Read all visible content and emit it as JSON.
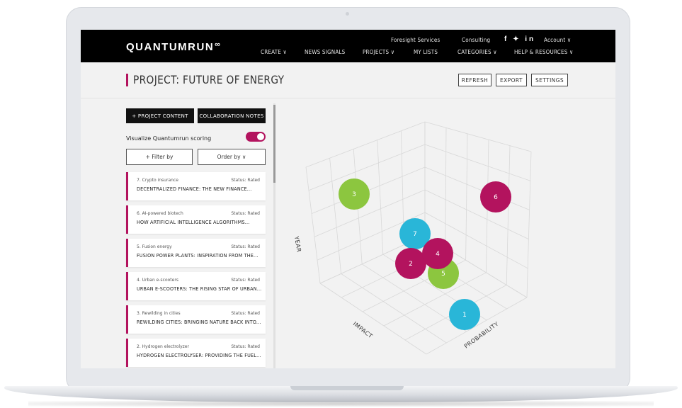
{
  "nav": {
    "logo": "QUANTUMRUN",
    "top": {
      "foresight": "Foresight Services",
      "consulting": "Consulting",
      "social": "f ✦ in",
      "account": "Account ∨"
    },
    "bottom": {
      "create": "CREATE ∨",
      "news": "NEWS SIGNALS",
      "projects": "PROJECTS ∨",
      "lists": "MY LISTS",
      "categories": "CATEGORIES ∨",
      "help": "HELP & RESOURCES ∨"
    }
  },
  "header": {
    "title": "PROJECT: FUTURE OF ENERGY",
    "refresh": "REFRESH",
    "export": "EXPORT",
    "settings": "SETTINGS"
  },
  "panel": {
    "project_content": "+ PROJECT CONTENT",
    "collab_notes": "COLLABORATION NOTES",
    "toggle_label": "Visualize Quantumrun scoring",
    "filter": "+ Filter by",
    "order": "Order by ∨",
    "items": [
      {
        "topic": "7. Crypto insurance",
        "status": "Status: Rated",
        "title": "DECENTRALIZED FINANCE: THE NEW FINANCE..."
      },
      {
        "topic": "6. AI-powered biotech",
        "status": "Status: Rated",
        "title": "HOW ARTIFICIAL INTELLIGENCE ALGORITHMS..."
      },
      {
        "topic": "5. Fusion energy",
        "status": "Status: Rated",
        "title": "FUSION POWER PLANTS: INSPIRATION FROM THE..."
      },
      {
        "topic": "4. Urban e-scooters",
        "status": "Status: Rated",
        "title": "URBAN E-SCOOTERS: THE RISING STAR OF URBAN..."
      },
      {
        "topic": "3. Rewilding in cities",
        "status": "Status: Rated",
        "title": "REWILDING CITIES: BRINGING NATURE BACK INTO..."
      },
      {
        "topic": "2. Hydrogen electrolyzer",
        "status": "Status: Rated",
        "title": "HYDROGEN ELECTROLYSER: PROVIDING THE FUEL..."
      }
    ]
  },
  "chart_data": {
    "type": "scatter",
    "axes": {
      "year": "YEAR",
      "impact": "IMPACT",
      "probability": "PROBABILITY"
    },
    "points": [
      {
        "label": "3",
        "color": "#8cc63f"
      },
      {
        "label": "6",
        "color": "#b3135e"
      },
      {
        "label": "7",
        "color": "#29b6d8"
      },
      {
        "label": "5",
        "color": "#8cc63f"
      },
      {
        "label": "2",
        "color": "#b3135e"
      },
      {
        "label": "4",
        "color": "#b3135e"
      },
      {
        "label": "1",
        "color": "#29b6d8"
      }
    ]
  },
  "colors": {
    "accent": "#b3135e",
    "green": "#8cc63f",
    "blue": "#29b6d8"
  }
}
